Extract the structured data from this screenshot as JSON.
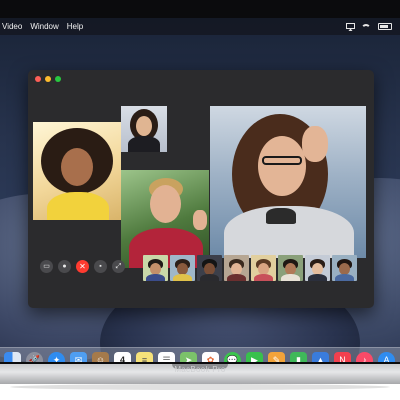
{
  "menubar": {
    "items": [
      "Video",
      "Window",
      "Help"
    ]
  },
  "window": {
    "app": "FaceTime"
  },
  "controls": [
    {
      "icon": "sidebar-icon",
      "glyph": "▭"
    },
    {
      "icon": "microphone-icon",
      "glyph": "●"
    },
    {
      "icon": "end-call-icon",
      "glyph": "✕"
    },
    {
      "icon": "camera-icon",
      "glyph": "▪"
    },
    {
      "icon": "fullscreen-icon",
      "glyph": "⤢"
    }
  ],
  "dock": {
    "icons": [
      "finder-icon",
      "launchpad-icon",
      "safari-icon",
      "mail-icon",
      "contacts-icon",
      "calendar-icon",
      "notes-icon",
      "reminders-icon",
      "maps-icon",
      "photos-icon",
      "messages-icon",
      "facetime-icon",
      "pages-icon",
      "numbers-icon",
      "keynote-icon",
      "news-icon",
      "music-icon",
      "app-store-icon",
      "system-preferences-icon",
      "folder-icon"
    ],
    "calendar_day": "4"
  },
  "device": {
    "label": "MacBook Pro"
  },
  "colors": {
    "end_call": "#ff3b30",
    "window_bg": "#2b2b2d"
  }
}
